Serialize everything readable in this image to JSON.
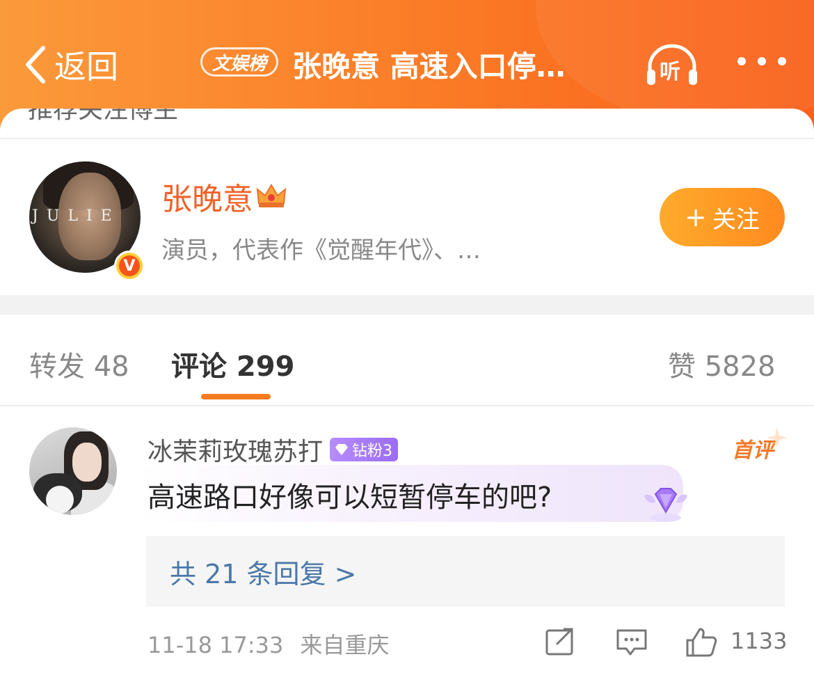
{
  "colors": {
    "header_start": "#fb9a3a",
    "header_end": "#f9601a",
    "accent": "#f0622a",
    "link": "#4a78a8",
    "tab_indicator": "#f87a1e"
  },
  "header": {
    "back_label": "返回",
    "tag": "文娱榜",
    "title": "张晚意 高速入口停…",
    "listen_label": "听",
    "icons": [
      "chevron-left-icon",
      "headphones-icon",
      "more-icon"
    ]
  },
  "card": {
    "clipped_text": "推荐关注博主"
  },
  "profile": {
    "name": "张晚意",
    "avatar_text": "JULIE",
    "verified_mark": "V",
    "description": "演员，代表作《觉醒年代》、…",
    "follow_label": "关注",
    "follow_plus": "+"
  },
  "tabs": [
    {
      "label": "转发 48",
      "active": false
    },
    {
      "label": "评论 299",
      "active": true
    },
    {
      "label": "赞 5828",
      "active": false
    }
  ],
  "comment": {
    "user": "冰茉莉玫瑰苏打",
    "fan_badge": "钻粉3",
    "first_badge": "首评",
    "text": "高速路口好像可以短暂停车的吧?",
    "replies": "共 21 条回复 >",
    "time": "11-18 17:33",
    "location": "来自重庆",
    "likes": "1133"
  }
}
